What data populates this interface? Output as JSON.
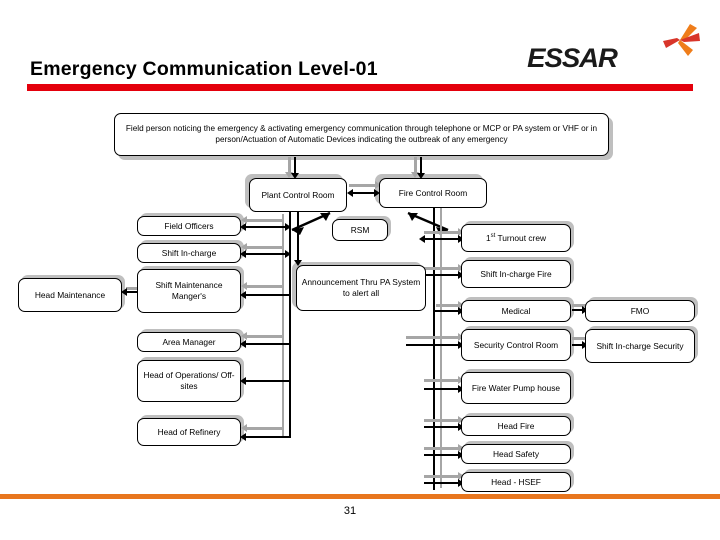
{
  "slide": {
    "title": "Emergency Communication Level-01",
    "page_number": "31",
    "brand": {
      "name": "ESSAR",
      "logo_icon": "essar-pinwheel-icon",
      "colors": {
        "orange": "#ef7d1a",
        "red": "#d8352a",
        "dark": "#1a1a1a"
      }
    },
    "accent_colors": {
      "title_rule": "#e4000c",
      "footer_rule": "#e8761e"
    }
  },
  "diagram": {
    "type": "flowchart",
    "nodes": {
      "trigger": "Field person noticing the emergency & activating emergency communication through telephone or MCP or PA system or VHF or in person/Actuation of Automatic Devices indicating the outbreak of any emergency",
      "plant_control_room": "Plant Control Room",
      "fire_control_room": "Fire Control Room",
      "rsm": "RSM",
      "announcement": "Announcement Thru PA System to alert all",
      "field_officers": "Field Officers",
      "shift_in_charge": "Shift In-charge",
      "shift_maintenance_managers": "Shift Maintenance Manger's",
      "head_maintenance": "Head Maintenance",
      "area_manager": "Area Manager",
      "head_of_operations": "Head of Operations/ Off-sites",
      "head_of_refinery": "Head of Refinery",
      "first_turnout_crew_prefix": "1",
      "first_turnout_crew_sup": "st",
      "first_turnout_crew_suffix": " Turnout crew",
      "shift_in_charge_fire": "Shift In-charge Fire",
      "medical": "Medical",
      "fmo": "FMO",
      "security_control_room": "Security Control Room",
      "shift_in_charge_security": "Shift In-charge Security",
      "fire_water_pump_house": "Fire Water Pump house",
      "head_fire": "Head Fire",
      "head_safety": "Head Safety",
      "head_hsef": "Head - HSEF"
    }
  }
}
